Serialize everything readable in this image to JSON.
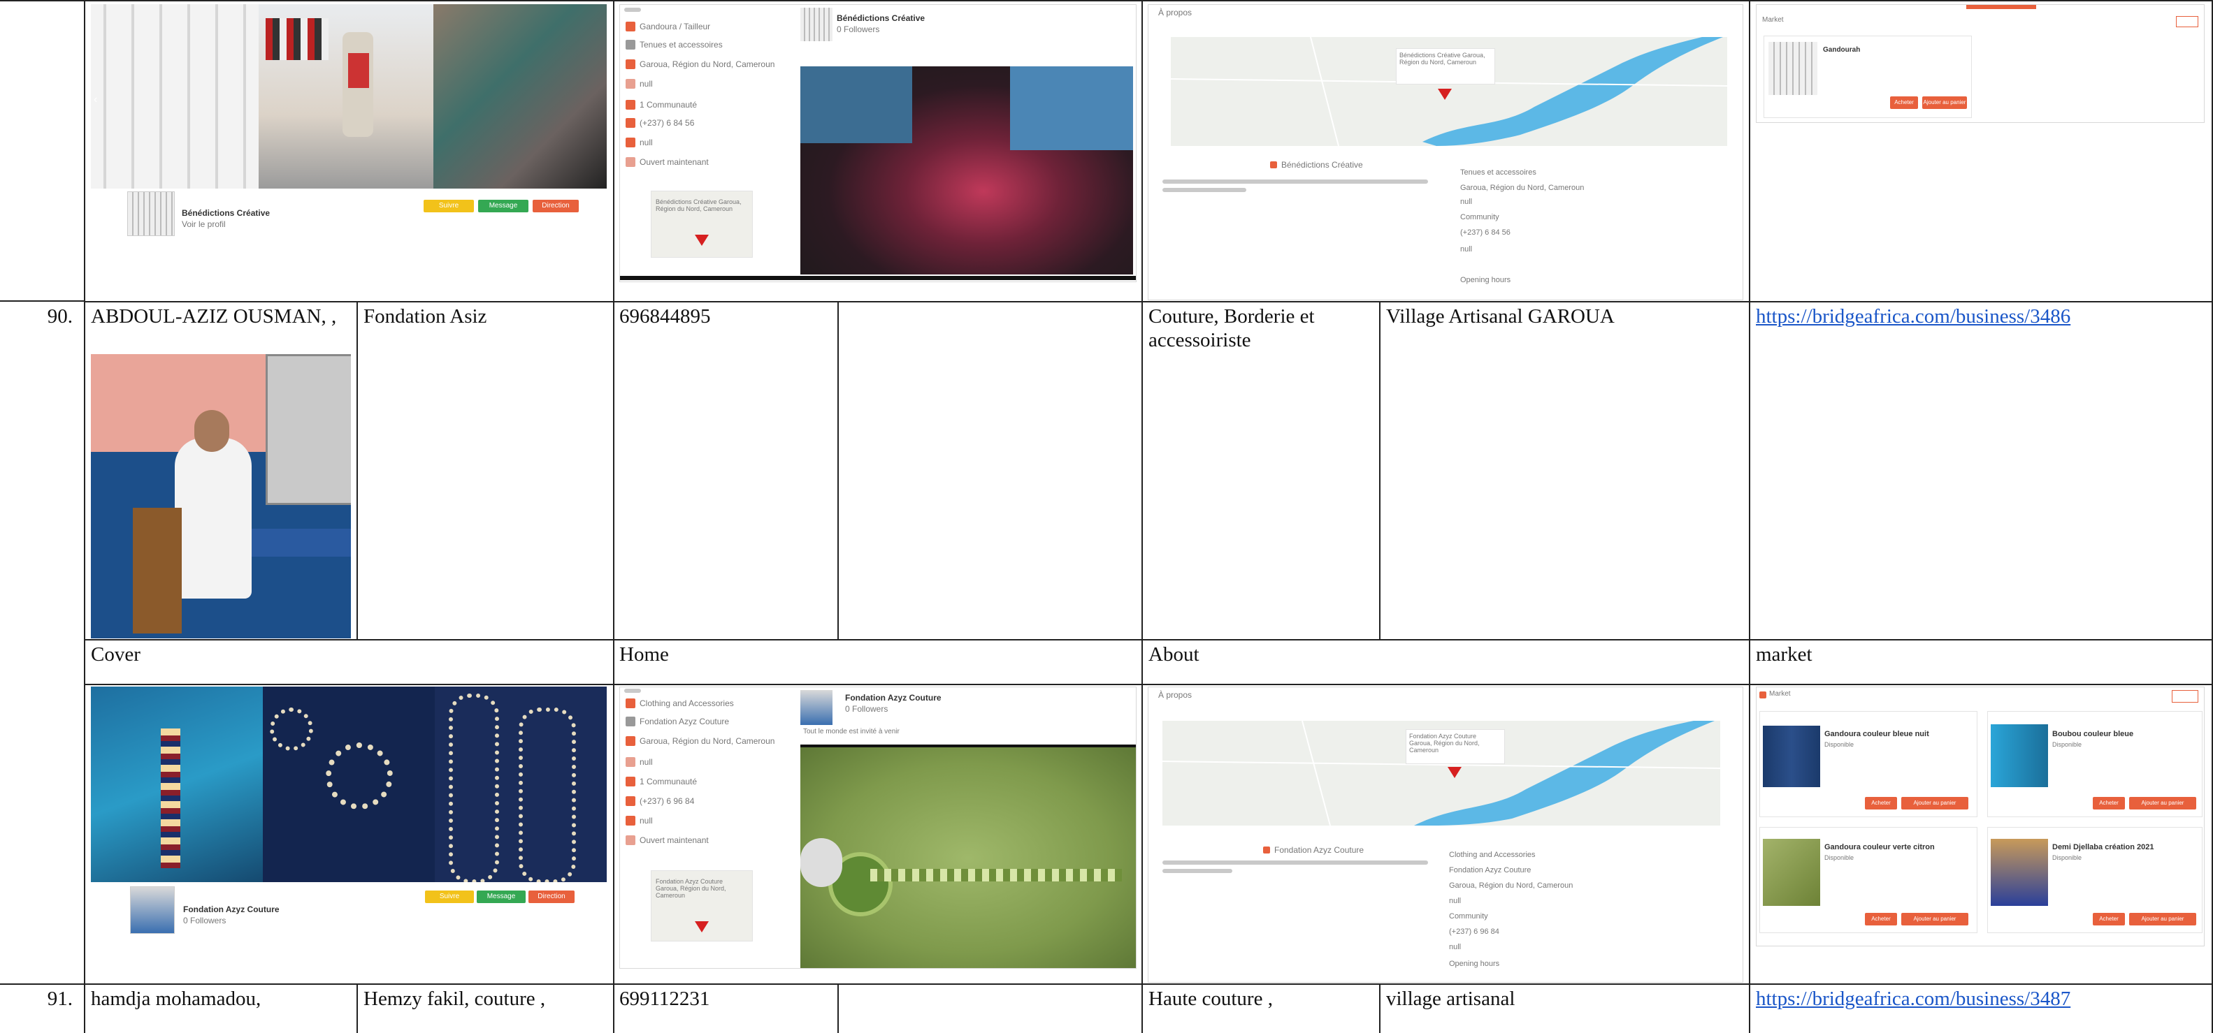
{
  "rows": [
    {
      "number": "90.",
      "name": "ABDOUL-AZIZ OUSMAN, ,",
      "business": "Fondation Asiz",
      "phone": "696844895",
      "activity": "Couture, Borderie et accessoiriste",
      "location": "Village Artisanal GAROUA",
      "url": "https://bridgeafrica.com/business/3486"
    },
    {
      "number": "91.",
      "name": "hamdja mohamadou,",
      "business": "Hemzy fakil, couture ,",
      "phone": "699112231",
      "activity": "Haute couture ,",
      "location": "village artisanal",
      "url": "https://bridgeafrica.com/business/3487"
    }
  ],
  "section_labels": {
    "cover": "Cover",
    "home": "Home",
    "about": "About",
    "market": "market"
  },
  "top_shots": {
    "cover_profile_name": "Bénédictions Créative",
    "cover_profile_sub": "Voir le profil",
    "cover_buttons": [
      "Suivre",
      "Message",
      "Direction"
    ],
    "home_title": "Bénédictions Créative",
    "home_followers": "0 Followers",
    "home_info": [
      "Gandoura / Tailleur",
      "Tenues et accessoires",
      "Garoua, Région du Nord, Cameroun",
      "null",
      "1 Communauté",
      "(+237) 6 84 56",
      "null",
      "Ouvert maintenant"
    ],
    "home_mapcard": "Bénédictions Créative Garoua, Région du Nord, Cameroun",
    "about_header": "À propos",
    "about_map_label": "Bénédictions Créative Garoua, Région du Nord, Cameroun",
    "about_name": "Bénédictions Créative",
    "about_details": [
      "Tenues et accessoires",
      "Garoua, Région du Nord, Cameroun",
      "null",
      "Community",
      "(+237) 6 84 56",
      "null",
      "Opening hours"
    ],
    "market_header": "Market",
    "market_item": "Gandourah",
    "market_buttons": [
      "Acheter",
      "Ajouter au panier"
    ]
  },
  "row90_shots": {
    "cover_profile_name": "Fondation Azyz Couture",
    "cover_profile_sub": "0 Followers",
    "cover_buttons": [
      "Suivre",
      "Message",
      "Direction"
    ],
    "home_title": "Fondation Azyz Couture",
    "home_followers": "0 Followers",
    "home_caption": "Tout le monde est invité à venir",
    "home_info": [
      "Clothing and Accessories",
      "Fondation Azyz Couture",
      "Garoua, Région du Nord, Cameroun",
      "null",
      "1 Communauté",
      "(+237) 6 96 84",
      "null",
      "Ouvert maintenant"
    ],
    "home_mapcard": "Fondation Azyz Couture Garoua, Région du Nord, Cameroun",
    "about_header": "À propos",
    "about_map_label": "Fondation Azyz Couture Garoua, Région du Nord, Cameroun",
    "about_name": "Fondation Azyz Couture",
    "about_details": [
      "Clothing and Accessories",
      "Fondation Azyz Couture",
      "Garoua, Région du Nord, Cameroun",
      "null",
      "Community",
      "(+237) 6 96 84",
      "null",
      "Opening hours"
    ],
    "market_header": "Market",
    "market_items": [
      {
        "title": "Gandoura couleur bleue nuit",
        "sub": "Disponible"
      },
      {
        "title": "Boubou couleur bleue",
        "sub": "Disponible"
      },
      {
        "title": "Gandoura couleur verte citron",
        "sub": "Disponible"
      },
      {
        "title": "Demi Djellaba création 2021",
        "sub": "Disponible"
      }
    ],
    "market_buttons": [
      "Acheter",
      "Ajouter au panier"
    ]
  },
  "colors": {
    "grid": "#222222",
    "link": "#1a56c8",
    "accent_orange": "#e8603c",
    "btn_yellow": "#f2c21a",
    "btn_green": "#34a853",
    "map_water": "#5cb8e6"
  }
}
